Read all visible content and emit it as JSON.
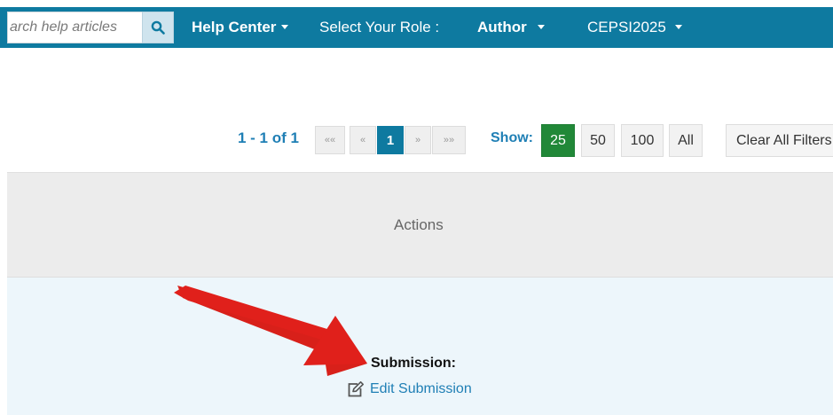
{
  "nav": {
    "search_placeholder": "arch help articles",
    "help_center": "Help Center",
    "role_prompt": "Select Your Role :",
    "role_value": "Author",
    "conference": "CEPSI2025"
  },
  "pager": {
    "summary": "1 - 1 of 1",
    "first": "««",
    "prev": "«",
    "current_page": "1",
    "next": "»",
    "last": "»»",
    "show_label": "Show:",
    "page_sizes": [
      "25",
      "50",
      "100",
      "All"
    ],
    "selected_page_size": "25",
    "clear_filters": "Clear All Filters"
  },
  "table": {
    "header_actions": "Actions",
    "row": {
      "submission_label": "Submission:",
      "edit_link": "Edit Submission"
    }
  },
  "colors": {
    "nav_bg": "#0e7aa0",
    "link": "#1f7fb5",
    "active_size": "#218838",
    "annotation_arrow": "#e0201b"
  },
  "icons": {
    "search": "search-icon",
    "caret": "caret-down-icon",
    "edit": "edit-icon",
    "annotation": "red-arrow-annotation"
  }
}
